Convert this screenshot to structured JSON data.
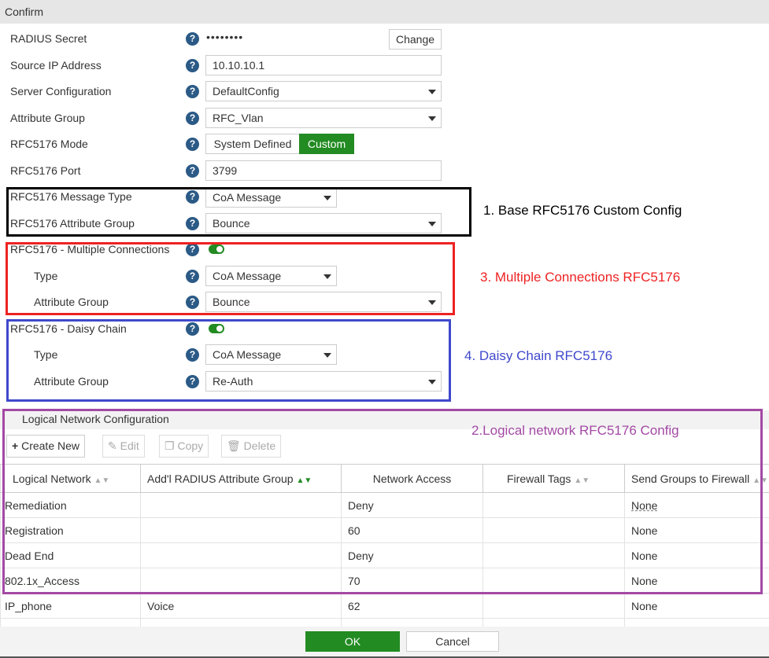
{
  "header": {
    "title": "Confirm"
  },
  "form": {
    "radius_secret": {
      "label": "RADIUS Secret",
      "value": "••••••••",
      "change": "Change"
    },
    "source_ip": {
      "label": "Source IP Address",
      "value": "10.10.10.1"
    },
    "server_config": {
      "label": "Server Configuration",
      "value": "DefaultConfig"
    },
    "attribute_group": {
      "label": "Attribute Group",
      "value": "RFC_Vlan"
    },
    "mode": {
      "label": "RFC5176 Mode",
      "options": [
        "System Defined",
        "Custom"
      ],
      "selected": "Custom"
    },
    "port": {
      "label": "RFC5176 Port",
      "value": "3799"
    },
    "msg_type": {
      "label": "RFC5176 Message Type",
      "value": "CoA Message"
    },
    "rfc_attr_group": {
      "label": "RFC5176 Attribute Group",
      "value": "Bounce"
    },
    "multi": {
      "label": "RFC5176 - Multiple Connections",
      "enabled": true,
      "type_label": "Type",
      "type": "CoA Message",
      "attr_label": "Attribute Group",
      "attr": "Bounce"
    },
    "daisy": {
      "label": "RFC5176 - Daisy Chain",
      "enabled": true,
      "type_label": "Type",
      "type": "CoA Message",
      "attr_label": "Attribute Group",
      "attr": "Re-Auth"
    }
  },
  "annotations": {
    "a1": "1. Base RFC5176 Custom Config",
    "a3": "3. Multiple Connections RFC5176",
    "a4": "4. Daisy Chain RFC5176",
    "a2": "2.Logical network RFC5176 Config"
  },
  "logical": {
    "title": "Logical Network Configuration",
    "toolbar": {
      "create": "Create New",
      "edit": "Edit",
      "copy": "Copy",
      "delete": "Delete"
    },
    "columns": [
      "Logical Network",
      "Add'l RADIUS Attribute Group",
      "Network Access",
      "Firewall Tags",
      "Send Groups to Firewall"
    ],
    "rows": [
      [
        "Remediation",
        "",
        "Deny",
        "",
        "None"
      ],
      [
        "Registration",
        "",
        "60",
        "",
        "None"
      ],
      [
        "Dead End",
        "",
        "Deny",
        "",
        "None"
      ],
      [
        "802.1x_Access",
        "",
        "70",
        "",
        "None"
      ],
      [
        "IP_phone",
        "Voice",
        "62",
        "",
        "None"
      ],
      [
        "",
        "",
        "",
        "",
        ""
      ]
    ]
  },
  "footer": {
    "ok": "OK",
    "cancel": "Cancel"
  },
  "colors": {
    "accent": "#228b22",
    "help": "#2b5a86",
    "box1": "#000000",
    "box3": "#ee2222",
    "box4": "#3f48cc",
    "box2": "#a349a4"
  }
}
